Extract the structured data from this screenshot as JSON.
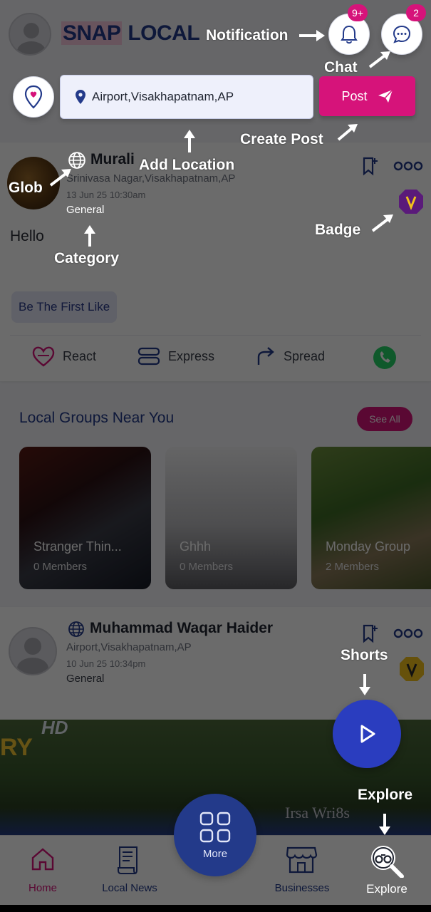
{
  "header": {
    "logo_snap": "SNAP",
    "logo_local": "LOCAL",
    "notification_count": "9+",
    "chat_count": "2"
  },
  "location": {
    "value": "Airport,Visakhapatnam,AP"
  },
  "post_button": {
    "label": "Post"
  },
  "post1": {
    "author": "Murali",
    "location": "Srinivasa Nagar,Visakhapatnam,AP",
    "date": "13 Jun 25 10:30am",
    "category": "General",
    "text": "Hello",
    "first_like": "Be The First Like",
    "actions": [
      "React",
      "Express",
      "Spread"
    ]
  },
  "groups": {
    "title": "Local Groups Near You",
    "see_all": "See All",
    "items": [
      {
        "name": "Stranger Thin...",
        "members": "0 Members"
      },
      {
        "name": "Ghhh",
        "members": "0 Members"
      },
      {
        "name": "Monday Group",
        "members": "2 Members"
      }
    ]
  },
  "post2": {
    "author": "Muhammad Waqar Haider",
    "location": "Airport,Visakhapatnam,AP",
    "date": "10 Jun 25 10:34pm",
    "category": "General",
    "media_hd": "HD",
    "media_ry": "RY",
    "media_watermark": "Irsa Wri8s"
  },
  "nav": {
    "home": "Home",
    "local_news": "Local News",
    "more": "More",
    "businesses": "Businesses",
    "explore": "Explore"
  },
  "annotations": {
    "notification": "Notification",
    "chat": "Chat",
    "create_post": "Create Post",
    "add_location": "Add Location",
    "glob": "Glob",
    "category": "Category",
    "badge": "Badge",
    "shorts": "Shorts",
    "explore": "Explore"
  },
  "colors": {
    "brand_pink": "#d6137a",
    "brand_navy": "#233a8a",
    "overlay": "rgba(0,0,0,0.58)"
  }
}
